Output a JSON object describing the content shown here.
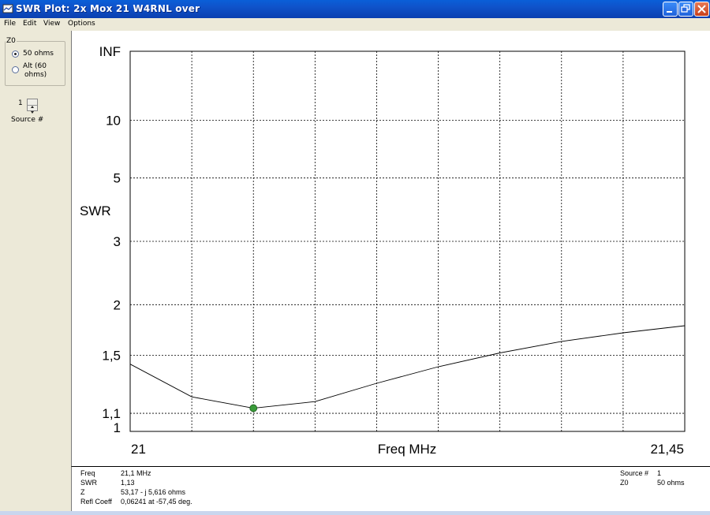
{
  "window": {
    "title": "SWR Plot:  2x Mox 21 W4RNL over"
  },
  "menu": {
    "items": [
      "File",
      "Edit",
      "View",
      "Options"
    ]
  },
  "left_panel": {
    "z0_group_label": "Z0",
    "radio_50_label": "50 ohms",
    "radio_alt_label_line1": "Alt (60",
    "radio_alt_label_line2": "ohms)",
    "radio_selected": "50 ohms",
    "source_value": "1",
    "source_label": "Source #"
  },
  "chart_data": {
    "type": "line",
    "title": "",
    "xlabel": "Freq MHz",
    "ylabel": "SWR",
    "x_tick_labels": [
      "21",
      "21,45"
    ],
    "xlim": [
      21.0,
      21.45
    ],
    "y_scale": "reflection-coefficient (SWR mapped to |rho|)",
    "y_tick_labels": [
      "INF",
      "10",
      "5",
      "3",
      "2",
      "1,5",
      "1,1",
      "1"
    ],
    "y_tick_values": [
      null,
      10,
      5,
      3,
      2,
      1.5,
      1.1,
      1
    ],
    "grid": true,
    "series": [
      {
        "x": [
          21.0,
          21.05,
          21.1,
          21.15,
          21.2,
          21.25,
          21.3,
          21.35,
          21.4,
          21.45
        ],
        "y": [
          1.43,
          1.2,
          1.13,
          1.17,
          1.29,
          1.41,
          1.52,
          1.62,
          1.7,
          1.77
        ],
        "color": "#000000"
      }
    ],
    "marker": {
      "x": 21.1,
      "y": 1.13,
      "color": "#3a9b3a"
    }
  },
  "status": {
    "freq_label": "Freq",
    "freq_value": "21,1 MHz",
    "swr_label": "SWR",
    "swr_value": "1,13",
    "z_label": "Z",
    "z_value": "53,17 - j 5,616 ohms",
    "refl_label": "Refl Coeff",
    "refl_value": "0,06241 at -57,45 deg.",
    "source_label": "Source #",
    "source_value": "1",
    "z0_label": "Z0",
    "z0_value": "50 ohms"
  }
}
